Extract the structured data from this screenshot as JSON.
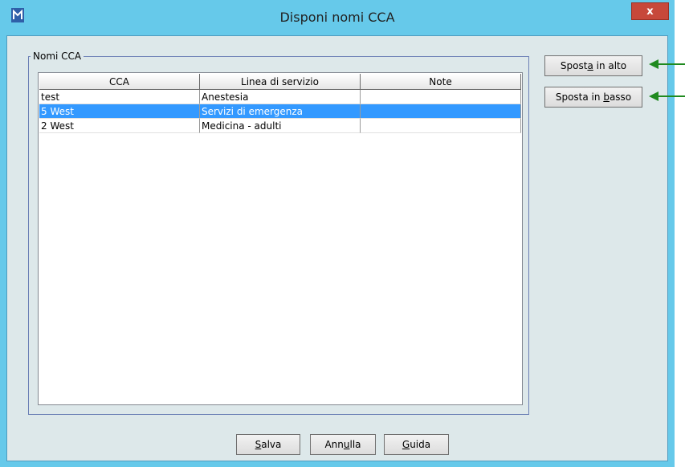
{
  "window": {
    "title": "Disponi nomi CCA",
    "close_label": "x"
  },
  "group": {
    "label": "Nomi CCA"
  },
  "table": {
    "columns": [
      "CCA",
      "Linea di servizio",
      "Note"
    ],
    "rows": [
      {
        "cca": "test",
        "service_line": "Anestesia",
        "note": "",
        "selected": false
      },
      {
        "cca": "5 West",
        "service_line": "Servizi di emergenza",
        "note": "",
        "selected": true
      },
      {
        "cca": "2 West",
        "service_line": "Medicina - adulti",
        "note": "",
        "selected": false
      }
    ]
  },
  "side_buttons": {
    "move_up": {
      "before": "Spost",
      "mnemonic": "a",
      "after": " in alto"
    },
    "move_down": {
      "before": "Sposta in ",
      "mnemonic": "b",
      "after": "asso"
    }
  },
  "footer_buttons": {
    "save": {
      "before": "",
      "mnemonic": "S",
      "after": "alva"
    },
    "cancel": {
      "before": "Ann",
      "mnemonic": "u",
      "after": "lla"
    },
    "help": {
      "before": "",
      "mnemonic": "G",
      "after": "uida"
    }
  },
  "colors": {
    "title_bar": "#66c9ea",
    "close_button": "#c7483a",
    "client_bg": "#dde8ea",
    "selection": "#3399ff",
    "annotation_arrow": "#1f8a1f"
  }
}
